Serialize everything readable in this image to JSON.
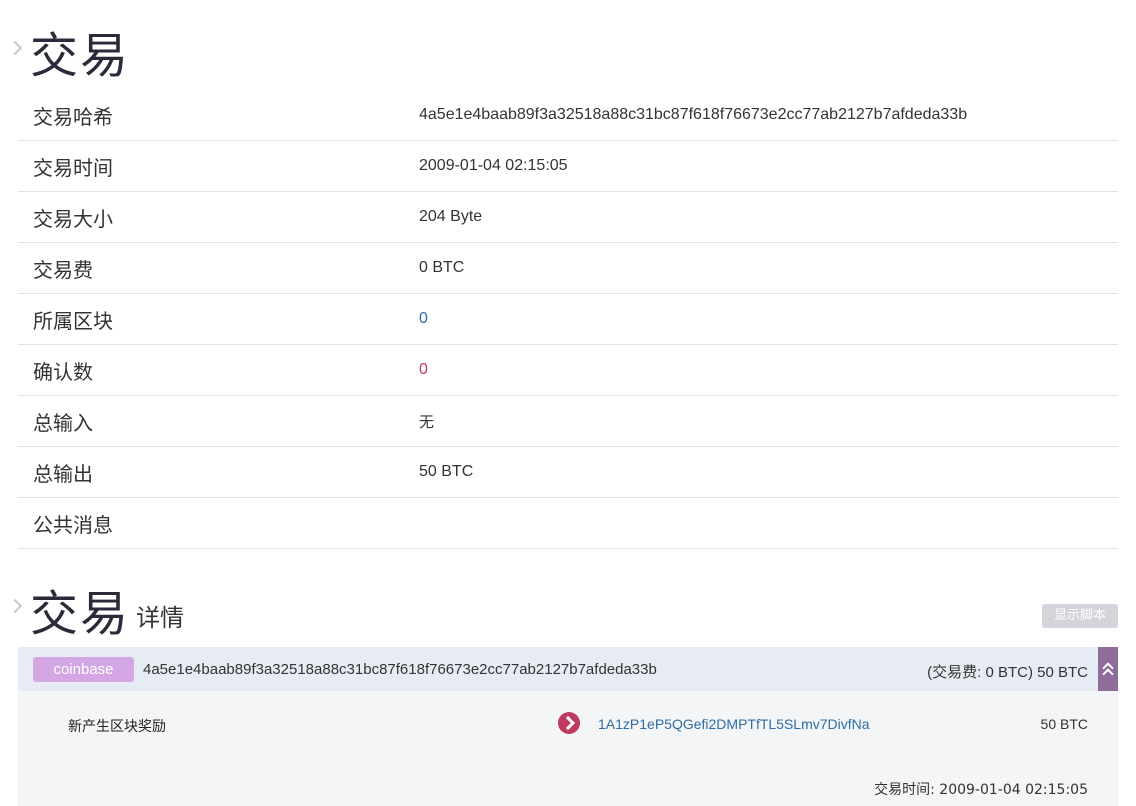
{
  "section1": {
    "title": "交易"
  },
  "info": [
    {
      "key": "交易哈希",
      "value": "4a5e1e4baab89f3a32518a88c31bc87f618f76673e2cc77ab2127b7afdeda33b"
    },
    {
      "key": "交易时间",
      "value": "2009-01-04 02:15:05"
    },
    {
      "key": "交易大小",
      "value": "204 Byte"
    },
    {
      "key": "交易费",
      "value": "0 BTC"
    },
    {
      "key": "所属区块",
      "value": "0"
    },
    {
      "key": "确认数",
      "value": "0"
    },
    {
      "key": "总输入",
      "value": "无"
    },
    {
      "key": "总输出",
      "value": "50 BTC"
    },
    {
      "key": "公共消息",
      "value": ""
    }
  ],
  "section2": {
    "title": "交易",
    "subtitle": "详情",
    "show_script_label": "显示脚本"
  },
  "tx": {
    "badge": "coinbase",
    "hash": "4a5e1e4baab89f3a32518a88c31bc87f618f76673e2cc77ab2127b7afdeda33b",
    "fee_summary": "(交易费: 0 BTC) 50 BTC",
    "input_label": "新产生区块奖励",
    "output_address": "1A1zP1eP5QGefi2DMPTfTL5SLmv7DivfNa",
    "output_amount": "50 BTC",
    "time_text": "交易时间: 2009-01-04 02:15:05"
  },
  "colors": {
    "link_blue": "#2e6da4",
    "accent_red": "#c0395e",
    "badge_purple": "#d4a6e3",
    "collapse_purple": "#8e6d9a"
  },
  "icons": {
    "section_caret": "chevron-right-icon",
    "output_arrow": "arrow-right-circle-icon",
    "collapse": "double-chevron-up-icon"
  }
}
